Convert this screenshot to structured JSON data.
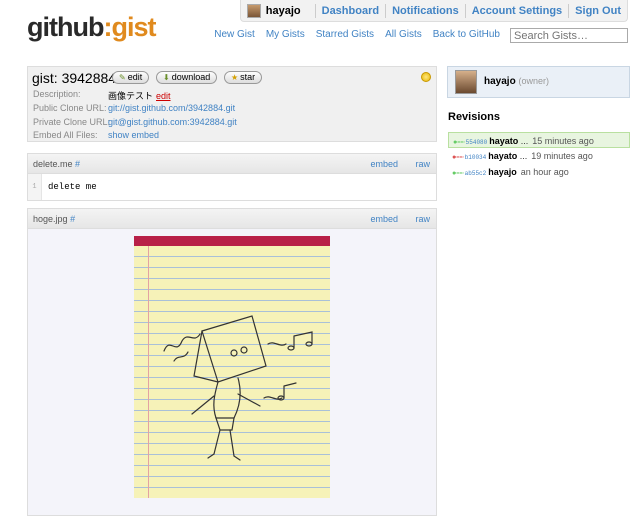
{
  "header": {
    "logo_main": "github",
    "logo_colon": ":",
    "logo_sub": "gist",
    "username": "hayajo",
    "nav": [
      "Dashboard",
      "Notifications",
      "Account Settings",
      "Sign Out"
    ],
    "subnav": [
      "New Gist",
      "My Gists",
      "Starred Gists",
      "All Gists",
      "Back to GitHub"
    ],
    "search_placeholder": "Search Gists…"
  },
  "gist": {
    "title": "gist: 3942884",
    "buttons": {
      "edit": "edit",
      "download": "download",
      "star": "star"
    },
    "meta": {
      "description_label": "Description:",
      "description_value": "画像テスト",
      "description_edit": "edit",
      "public_label": "Public Clone URL:",
      "public_value": "git://gist.github.com/3942884.git",
      "private_label": "Private Clone URL:",
      "private_value": "git@gist.github.com:3942884.git",
      "embed_label": "Embed All Files:",
      "embed_value": "show embed"
    }
  },
  "files": [
    {
      "name": "delete.me",
      "hash": "#",
      "embed": "embed",
      "raw": "raw",
      "line_no": "1",
      "line": "delete me"
    },
    {
      "name": "hoge.jpg",
      "hash": "#",
      "embed": "embed",
      "raw": "raw"
    }
  ],
  "sidebar": {
    "owner_name": "hayajo",
    "owner_role": "(owner)",
    "revisions_title": "Revisions",
    "revisions": [
      {
        "sha": "554080",
        "user": "hayato",
        "when": "15 minutes ago"
      },
      {
        "sha": "b10034",
        "user": "hayato",
        "when": "19 minutes ago"
      },
      {
        "sha": "ab55c2",
        "user": "hayajo",
        "when": "an hour ago"
      }
    ]
  }
}
